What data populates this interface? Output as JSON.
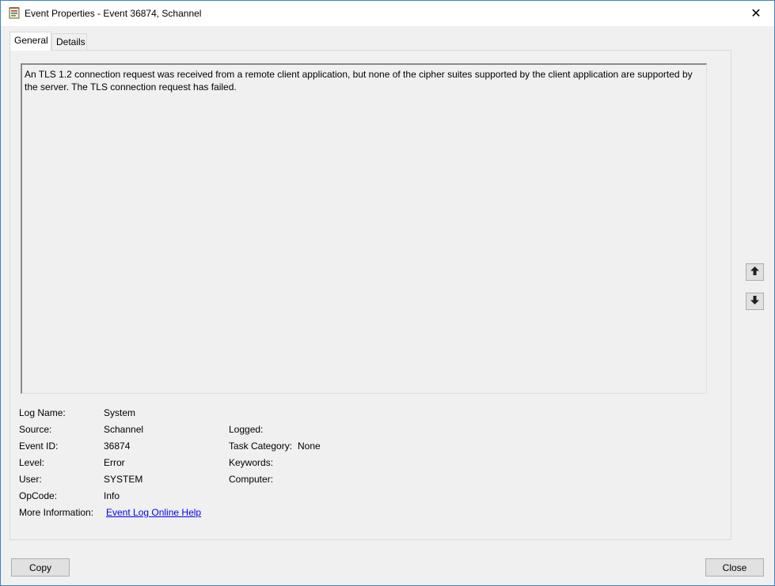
{
  "window": {
    "title": "Event Properties - Event 36874, Schannel",
    "close_glyph": "✕"
  },
  "tabs": [
    {
      "label": "General",
      "active": true
    },
    {
      "label": "Details",
      "active": false
    }
  ],
  "general": {
    "description": "An TLS 1.2 connection request was received from a remote client application, but none of the cipher suites supported by the client application are supported by the server. The TLS connection request has failed.",
    "fields": {
      "log_name": {
        "label": "Log Name:",
        "value": "System"
      },
      "source": {
        "label": "Source:",
        "value": "Schannel"
      },
      "event_id": {
        "label": "Event ID:",
        "value": "36874"
      },
      "level": {
        "label": "Level:",
        "value": "Error"
      },
      "user": {
        "label": "User:",
        "value": "SYSTEM"
      },
      "opcode": {
        "label": "OpCode:",
        "value": "Info"
      },
      "more_information": {
        "label": "More Information:",
        "value": "Event Log Online Help"
      },
      "logged": {
        "label": "Logged:",
        "value": ""
      },
      "task_category": {
        "label": "Task Category:",
        "value": "None"
      },
      "keywords": {
        "label": "Keywords:",
        "value": ""
      },
      "computer": {
        "label": "Computer:",
        "value": ""
      }
    }
  },
  "buttons": {
    "copy": "Copy",
    "close": "Close"
  },
  "icons": {
    "up": "up-arrow-icon",
    "down": "down-arrow-icon"
  },
  "colors": {
    "link": "#0000ee",
    "window_border": "#3c82c8",
    "background": "#f0f0f0"
  }
}
